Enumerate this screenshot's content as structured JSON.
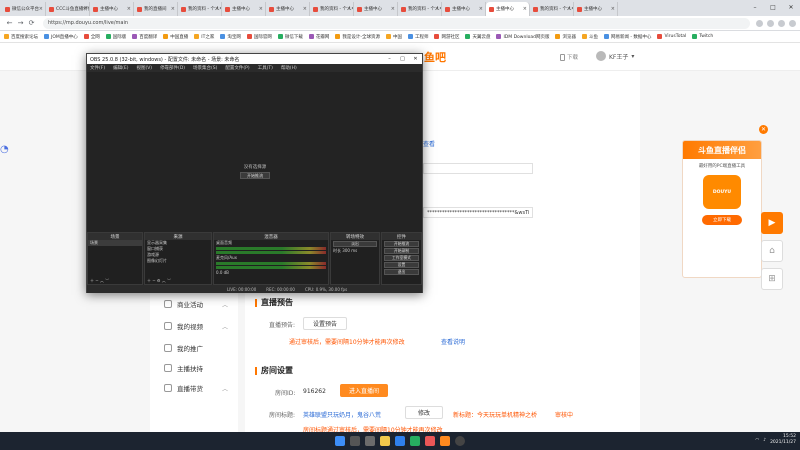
{
  "browser": {
    "tabs": [
      "微信公众平台",
      "CCC斗鱼直播伴侣",
      "主播中心",
      "我的直播间",
      "我的资料 - 个人中心",
      "主播中心",
      "主播中心",
      "我的资料 - 个人中心",
      "主播中心",
      "我的资料 - 个人中心",
      "主播中心",
      "主播中心",
      "我的资料 - 个人中心",
      "主播中心"
    ],
    "active_tab_index": 11,
    "url": "https://mp.douyu.com/live/main",
    "bookmarks": [
      "百度搜索论坛",
      "JOM直播中心",
      "全网",
      "国际版",
      "百度翻译",
      "中国直播",
      "IT之家",
      "淘宝网",
      "国际官网",
      "微信下载",
      "花瓣网",
      "我是设计-全球资源",
      "中国",
      "工程师",
      "网游社区",
      "天翼云盘",
      "IDM Download网页版",
      "浏览器",
      "斗鱼",
      "网易新闻 - 数据中心",
      "VirusTotal",
      "Twitch"
    ]
  },
  "site": {
    "logo": "鱼吧",
    "download": "下载",
    "username": "KF王子"
  },
  "sidebar": {
    "items": [
      {
        "label": "商业活动"
      },
      {
        "label": "我的视频"
      },
      {
        "label": "我的推广"
      },
      {
        "label": "主播扶持"
      },
      {
        "label": "直播带货"
      }
    ]
  },
  "content": {
    "link_top": "查看",
    "token_value": "***********************************&wsTi",
    "preview_section": "直播预告",
    "preview_label": "直播预告:",
    "preview_button": "设置预告",
    "preview_warning": "通过审核后，需要间隔10分钟才能再次修改",
    "preview_link": "查看说明",
    "room_section": "房间设置",
    "room_id_label": "房间ID:",
    "room_id_value": "916262",
    "enter_room_button": "进入直播间",
    "room_title_label": "房间标题:",
    "room_title_value": "英雄联盟只玩奶月，鬼谷八荒",
    "modify_button": "修改",
    "new_title_label": "新标题：今天玩玩单机精神之桥",
    "new_title_status": "审核中",
    "bottom_warning": "房间标题通过审核后，需要间隔10分钟才能再次修改"
  },
  "ad": {
    "title": "斗鱼直播伴侣",
    "subtitle": "最好用的PC端直播工具",
    "image_text": "DOUYU",
    "button": "立即下载"
  },
  "obs": {
    "title": "OBS 25.0.8 (32-bit, windows) - 配置文件: 未命名 - 场景: 未命名",
    "menu": [
      "文件(F)",
      "编辑(E)",
      "视图(V)",
      "停靠部件(D)",
      "场景集合(S)",
      "配置文件(P)",
      "工具(T)",
      "帮助(H)"
    ],
    "no_source": "没有选择源",
    "filters_button": "开始推流",
    "docks": {
      "scenes": {
        "title": "场景",
        "items": [
          "场景"
        ]
      },
      "sources": {
        "title": "来源",
        "items": [
          "显示器采集",
          "窗口捕获",
          "游戏源",
          "图像幻灯片"
        ]
      },
      "mixer": {
        "title": "混音器",
        "channels": [
          "桌面音频",
          "麦克风/Aux"
        ],
        "db": "0.0 dB"
      },
      "transitions": {
        "title": "转场特效",
        "fade": "淡出",
        "duration_label": "时长",
        "duration": "300 ms"
      },
      "controls": {
        "title": "控件",
        "buttons": [
          "开始推流",
          "开始录制",
          "工作室模式",
          "设置",
          "退出"
        ]
      }
    },
    "status": {
      "live": "LIVE: 00:00:00",
      "rec": "REC: 00:00:00",
      "cpu": "CPU: 0.9%, 30.00 fps"
    }
  },
  "taskbar": {
    "time": "15:52",
    "date": "2021/11/27"
  }
}
